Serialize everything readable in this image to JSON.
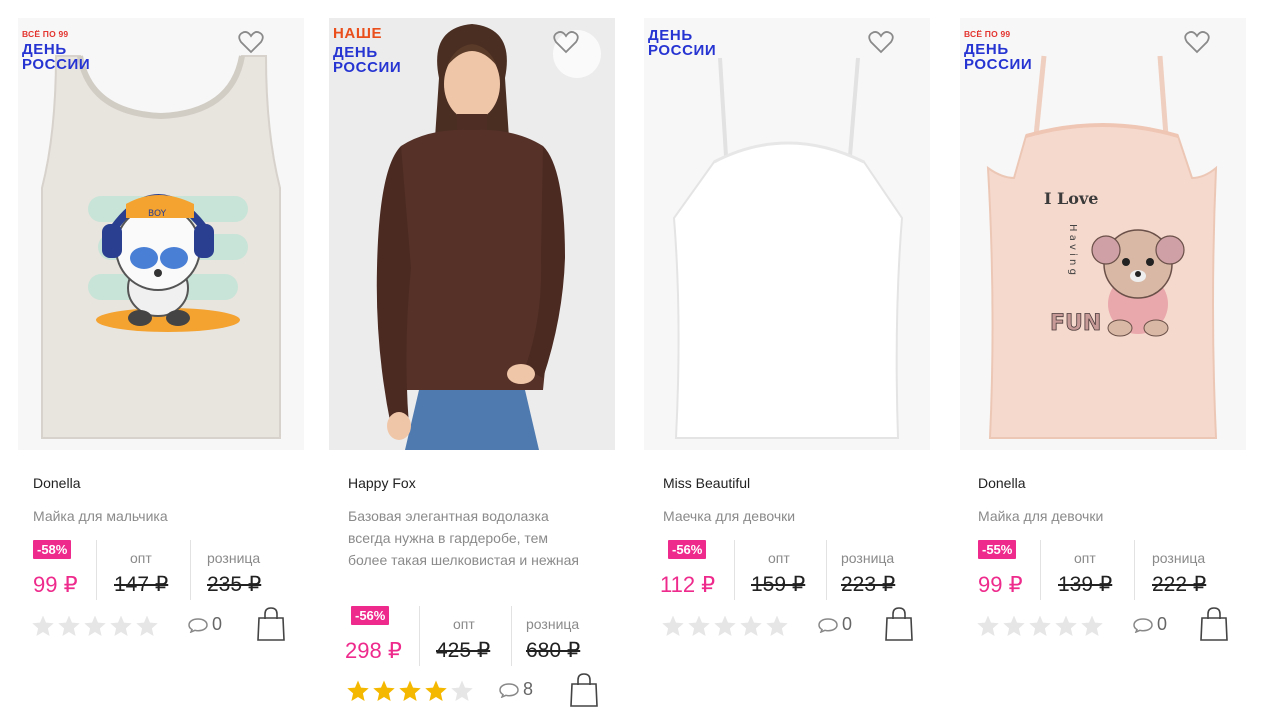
{
  "products": [
    {
      "badge_small": "ВСЁ ПО 99",
      "badge_line1": "ДЕНЬ",
      "badge_line2": "РОССИИ",
      "brand": "Donella",
      "description": "Майка для мальчика",
      "discount": "-58%",
      "price": "99 ₽",
      "opt_label": "опт",
      "opt_price": "147 ₽",
      "retail_label": "розница",
      "retail_price": "235 ₽",
      "rating": 0,
      "comments": "0"
    },
    {
      "badge_big": "НАШЕ",
      "badge_line1": "ДЕНЬ",
      "badge_line2": "РОССИИ",
      "brand": "Happy Fox",
      "description": "Базовая элегантная водолазка всегда нужна в гардеробе, тем более такая шелковистая и нежная",
      "discount": "-56%",
      "price": "298 ₽",
      "opt_label": "опт",
      "opt_price": "425 ₽",
      "retail_label": "розница",
      "retail_price": "680 ₽",
      "rating": 4,
      "comments": "8"
    },
    {
      "badge_line1": "ДЕНЬ",
      "badge_line2": "РОССИИ",
      "brand": "Miss Beautiful",
      "description": "Маечка для девочки",
      "discount": "-56%",
      "price": "112 ₽",
      "opt_label": "опт",
      "opt_price": "159 ₽",
      "retail_label": "розница",
      "retail_price": "223 ₽",
      "rating": 0,
      "comments": "0"
    },
    {
      "badge_small": "ВСЁ ПО 99",
      "badge_line1": "ДЕНЬ",
      "badge_line2": "РОССИИ",
      "brand": "Donella",
      "description": "Майка для девочки",
      "discount": "-55%",
      "price": "99 ₽",
      "opt_label": "опт",
      "opt_price": "139 ₽",
      "retail_label": "розница",
      "retail_price": "222 ₽",
      "rating": 0,
      "comments": "0"
    }
  ],
  "image_text": {
    "boy_cap": "BOY",
    "girl_print_line1": "I Love",
    "girl_print_vertical": "H a v i n g",
    "girl_print_line3": "FUN"
  },
  "colors": {
    "discount": "#ee2a8c",
    "price": "#ee2a8c",
    "promo_blue": "#2634d2",
    "promo_red": "#e94e1b",
    "star_filled": "#f5b800",
    "star_empty": "#e6e6e6"
  },
  "icons": {
    "favorite": "heart-icon",
    "comments": "speech-bubble-icon",
    "cart": "shopping-bag-icon",
    "rating": "star-icon"
  }
}
